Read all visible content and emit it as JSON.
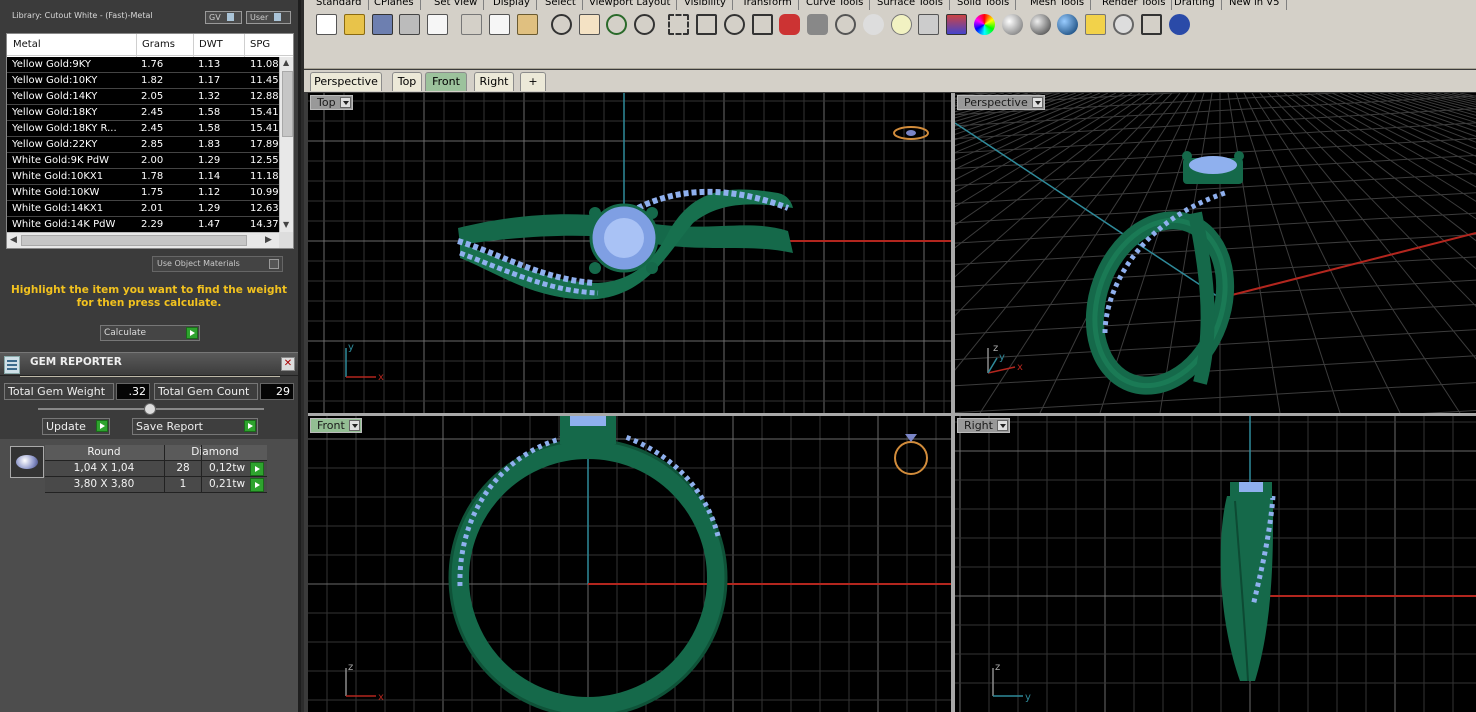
{
  "library": {
    "title": "Library: Cutout White - (Fast)-Metal",
    "gv_label": "GV",
    "user_label": "User"
  },
  "metal_table": {
    "headers": [
      "Metal",
      "Grams",
      "DWT",
      "SPG"
    ],
    "rows": [
      [
        "Yellow Gold:9KY",
        "1.76",
        "1.13",
        "11.08"
      ],
      [
        "Yellow Gold:10KY",
        "1.82",
        "1.17",
        "11.45"
      ],
      [
        "Yellow Gold:14KY",
        "2.05",
        "1.32",
        "12.88"
      ],
      [
        "Yellow Gold:18KY",
        "2.45",
        "1.58",
        "15.41"
      ],
      [
        "Yellow Gold:18KY R...",
        "2.45",
        "1.58",
        "15.41"
      ],
      [
        "Yellow Gold:22KY",
        "2.85",
        "1.83",
        "17.89"
      ],
      [
        "White Gold:9K PdW",
        "2.00",
        "1.29",
        "12.55"
      ],
      [
        "White Gold:10KX1",
        "1.78",
        "1.14",
        "11.18"
      ],
      [
        "White Gold:10KW",
        "1.75",
        "1.12",
        "10.99"
      ],
      [
        "White Gold:14KX1",
        "2.01",
        "1.29",
        "12.63"
      ],
      [
        "White Gold:14K PdW",
        "2.29",
        "1.47",
        "14.37"
      ]
    ]
  },
  "use_object_materials": "Use Object Materials",
  "hint_text": "Highlight the item you want to find the weight for then press calculate.",
  "calculate_label": "Calculate",
  "gem_reporter": {
    "title": "GEM REPORTER",
    "total_weight_label": "Total Gem Weight",
    "total_weight_value": ".32",
    "total_count_label": "Total Gem Count",
    "total_count_value": "29",
    "update_label": "Update",
    "save_report_label": "Save Report",
    "table_headers": [
      "Round",
      "Diamond"
    ],
    "rows": [
      [
        "1,04 X 1,04",
        "28",
        "0,12tw"
      ],
      [
        "3,80 X 3,80",
        "1",
        "0,21tw"
      ]
    ]
  },
  "menu_tabs": [
    "Standard",
    "CPlanes",
    "Set View",
    "Display",
    "Select",
    "Viewport Layout",
    "Visibility",
    "Transform",
    "Curve Tools",
    "Surface Tools",
    "Solid Tools",
    "Mesh Tools",
    "Render Tools",
    "Drafting",
    "New in V5"
  ],
  "toolbar_icons": [
    "new-icon",
    "open-icon",
    "save-icon",
    "print-icon",
    "import-icon",
    "cut-icon",
    "copy-icon",
    "paste-icon",
    "undo-icon",
    "pan-hand-icon",
    "rotate-view-icon",
    "zoom-icon",
    "zoom-window-icon",
    "zoom-extents-icon",
    "zoom-selected-icon",
    "four-view-icon",
    "car-icon",
    "camera-icon",
    "shade-icon",
    "ghost-icon",
    "light-bulb-icon",
    "lock-icon",
    "layer-icon",
    "color-wheel-icon",
    "render-sphere-icon",
    "env-sphere-icon",
    "blue-sphere-icon",
    "select-filter-icon",
    "settings-gear-icon",
    "grid-snap-icon",
    "help-icon"
  ],
  "viewport_tabs": [
    "Perspective",
    "Top",
    "Front",
    "Right",
    "+"
  ],
  "viewports": {
    "top": {
      "label": "Top",
      "axis_v": "y",
      "axis_h": "x"
    },
    "perspective": {
      "label": "Perspective",
      "axis_v": "z",
      "axis_h": "x",
      "axis_d": "y"
    },
    "front": {
      "label": "Front",
      "axis_v": "z",
      "axis_h": "x"
    },
    "right": {
      "label": "Right",
      "axis_v": "z",
      "axis_h": "y"
    }
  },
  "colors": {
    "ring": "#15694a",
    "gem": "#8fb0ee",
    "grid": "#3e3e3e",
    "axis_x": "#b3261e",
    "axis_y": "#2f8a9a",
    "active_tab": "#9cc29c",
    "hint": "#f2c21f"
  }
}
